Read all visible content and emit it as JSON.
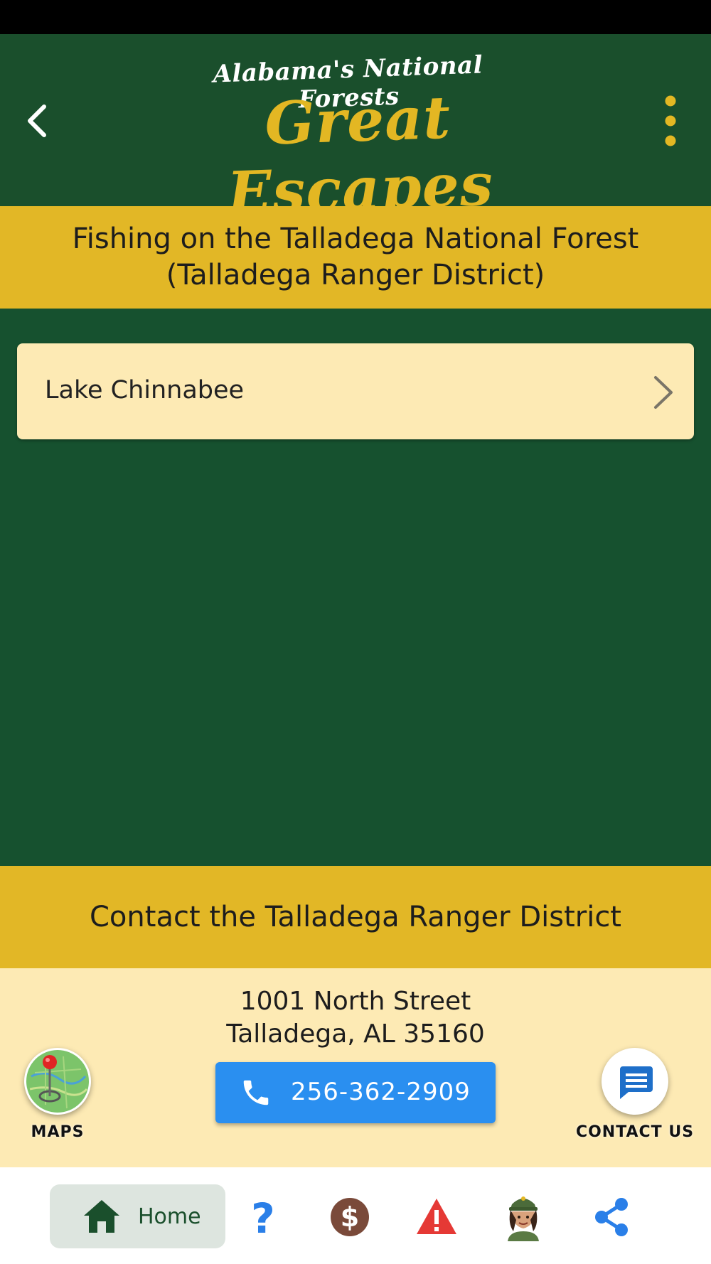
{
  "header": {
    "logo_top": "Alabama's National Forests",
    "logo_main": "Great Escapes",
    "brand_green": "#1a4f2c",
    "brand_gold": "#e3b723"
  },
  "page": {
    "title_line1": "Fishing on the Talladega National Forest",
    "title_line2": "(Talladega Ranger District)"
  },
  "list": {
    "items": [
      {
        "label": "Lake Chinnabee"
      }
    ]
  },
  "contact": {
    "title": "Contact the Talladega Ranger District",
    "address_line1": "1001 North Street",
    "address_line2": "Talladega, AL 35160",
    "phone": "256-362-2909"
  },
  "fabs": {
    "maps_label": "MAPS",
    "contact_label": "CONTACT US"
  },
  "bottom_nav": {
    "home_label": "Home",
    "icons": [
      "home-icon",
      "help-icon",
      "fees-icon",
      "alerts-icon",
      "ranger-icon",
      "share-icon"
    ]
  }
}
